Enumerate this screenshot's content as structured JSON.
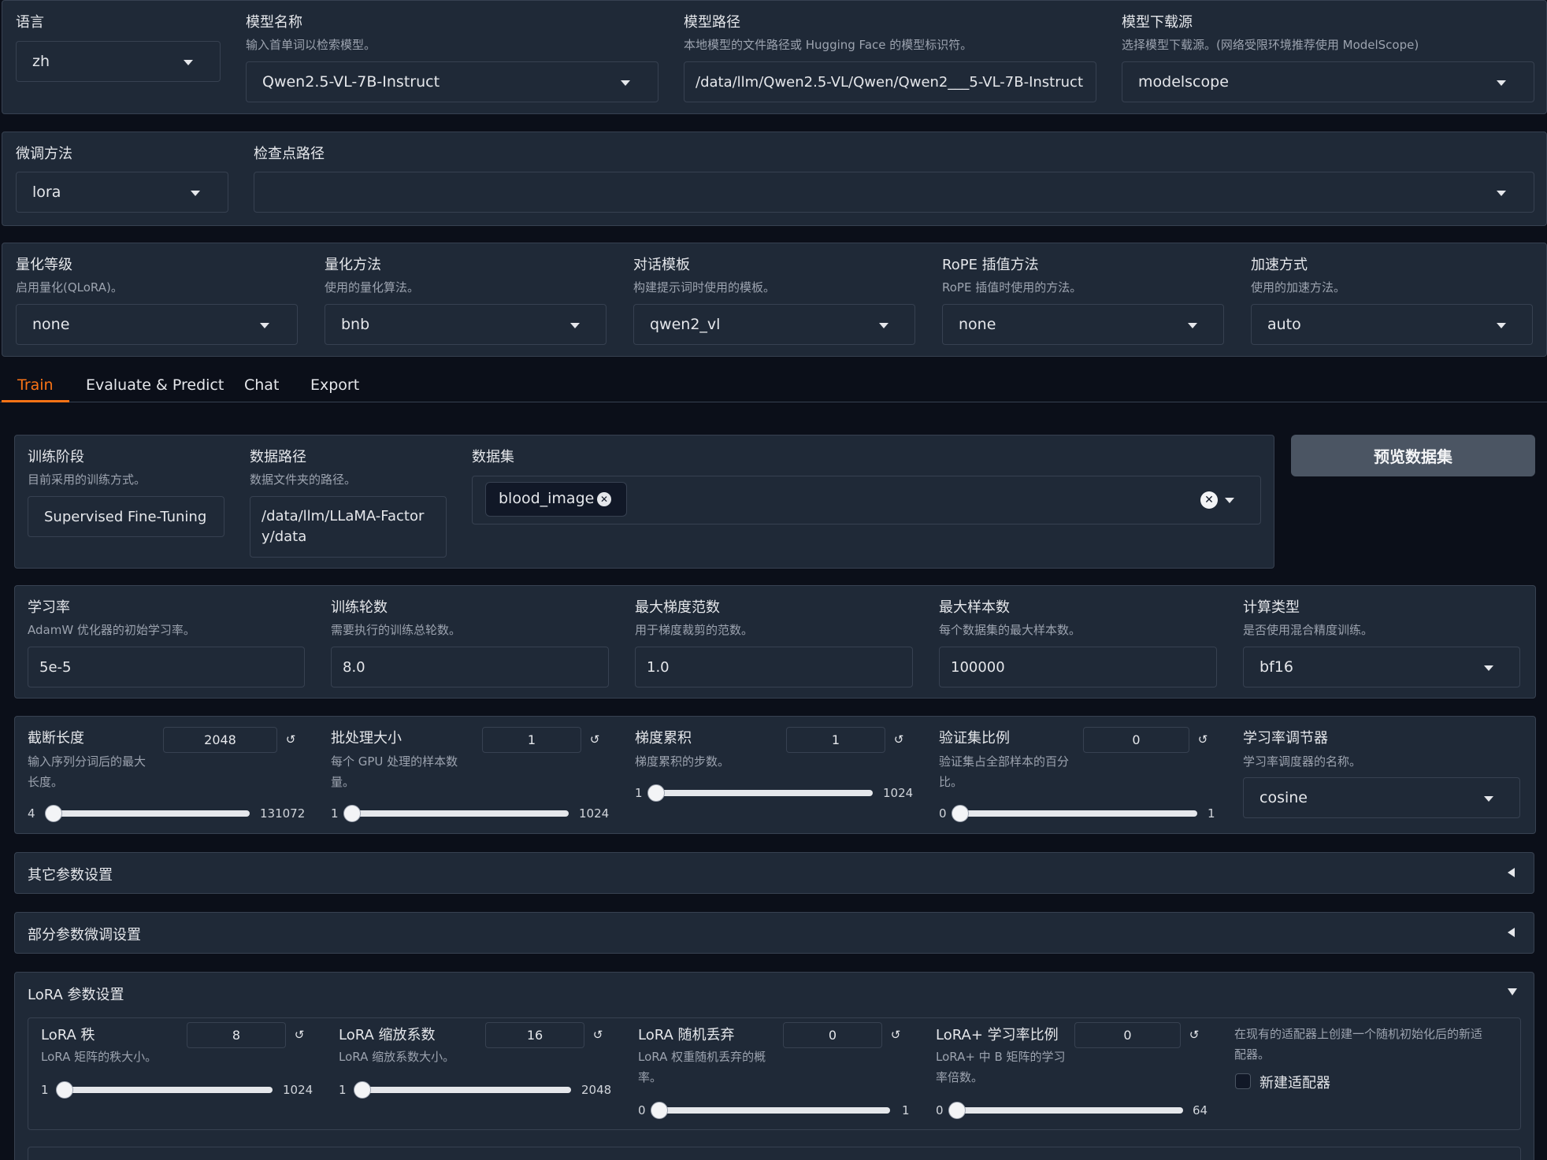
{
  "top": {
    "lang": {
      "label": "语言",
      "value": "zh"
    },
    "model_name": {
      "label": "模型名称",
      "info": "输入首单词以检索模型。",
      "value": "Qwen2.5-VL-7B-Instruct"
    },
    "model_path": {
      "label": "模型路径",
      "info": "本地模型的文件路径或 Hugging Face 的模型标识符。",
      "value": "/data/llm/Qwen2.5-VL/Qwen/Qwen2___5-VL-7B-Instruct"
    },
    "hub": {
      "label": "模型下载源",
      "info": "选择模型下载源。(网络受限环境推荐使用 ModelScope)",
      "value": "modelscope"
    }
  },
  "finetune": {
    "method": {
      "label": "微调方法",
      "value": "lora"
    },
    "checkpoint": {
      "label": "检查点路径",
      "value": ""
    }
  },
  "quant": {
    "bit": {
      "label": "量化等级",
      "info": "启用量化(QLoRA)。",
      "value": "none"
    },
    "method": {
      "label": "量化方法",
      "info": "使用的量化算法。",
      "value": "bnb"
    },
    "template": {
      "label": "对话模板",
      "info": "构建提示词时使用的模板。",
      "value": "qwen2_vl"
    },
    "rope": {
      "label": "RoPE 插值方法",
      "info": "RoPE 插值时使用的方法。",
      "value": "none"
    },
    "booster": {
      "label": "加速方式",
      "info": "使用的加速方法。",
      "value": "auto"
    }
  },
  "tabs": [
    {
      "label": "Train",
      "active": true
    },
    {
      "label": "Evaluate & Predict",
      "active": false
    },
    {
      "label": "Chat",
      "active": false
    },
    {
      "label": "Export",
      "active": false
    }
  ],
  "accent_color": "#f97316",
  "train": {
    "stage": {
      "label": "训练阶段",
      "info": "目前采用的训练方式。",
      "value": "Supervised Fine-Tuning"
    },
    "dataset_dir": {
      "label": "数据路径",
      "info": "数据文件夹的路径。",
      "value": "/data/llm/LLaMA-Factory/data"
    },
    "dataset": {
      "label": "数据集",
      "chip": "blood_image"
    },
    "preview_button": "预览数据集"
  },
  "params1": {
    "lr": {
      "label": "学习率",
      "info": "AdamW 优化器的初始学习率。",
      "value": "5e-5"
    },
    "epochs": {
      "label": "训练轮数",
      "info": "需要执行的训练总轮数。",
      "value": "8.0"
    },
    "max_grad_norm": {
      "label": "最大梯度范数",
      "info": "用于梯度裁剪的范数。",
      "value": "1.0"
    },
    "max_samples": {
      "label": "最大样本数",
      "info": "每个数据集的最大样本数。",
      "value": "100000"
    },
    "compute_type": {
      "label": "计算类型",
      "info": "是否使用混合精度训练。",
      "value": "bf16"
    }
  },
  "params2": {
    "cutoff": {
      "label": "截断长度",
      "info1": "输入序列分词后的最大",
      "info2": "长度。",
      "value": "2048",
      "min": "4",
      "max": "131072",
      "level": 0.0156
    },
    "batch": {
      "label": "批处理大小",
      "info1": "每个 GPU 处理的样本数",
      "info2": "量。",
      "value": "1",
      "min": "1",
      "max": "1024",
      "level": 0.0
    },
    "grad_acc": {
      "label": "梯度累积",
      "info1": "梯度累积的步数。",
      "value": "1",
      "min": "1",
      "max": "1024",
      "level": 0.0
    },
    "val_size": {
      "label": "验证集比例",
      "info1": "验证集占全部样本的百分",
      "info2": "比。",
      "value": "0",
      "min": "0",
      "max": "1",
      "level": 0.0
    },
    "scheduler": {
      "label": "学习率调节器",
      "info": "学习率调度器的名称。",
      "value": "cosine"
    }
  },
  "accordions": {
    "extra": "其它参数设置",
    "freeze": "部分参数微调设置",
    "lora": "LoRA 参数设置"
  },
  "lora": {
    "rank": {
      "label": "LoRA 秩",
      "info": "LoRA 矩阵的秩大小。",
      "value": "8",
      "min": "1",
      "max": "1024",
      "level": 0.0068
    },
    "alpha": {
      "label": "LoRA 缩放系数",
      "info": "LoRA 缩放系数大小。",
      "value": "16",
      "min": "1",
      "max": "2048",
      "level": 0.0073
    },
    "dropout": {
      "label": "LoRA 随机丢弃",
      "info1": "LoRA 权重随机丢弃的概",
      "info2": "率。",
      "value": "0",
      "min": "0",
      "max": "1",
      "level": 0.0
    },
    "plus_ratio": {
      "label": "LoRA+ 学习率比例",
      "info1": "LoRA+ 中 B 矩阵的学习",
      "info2": "率倍数。",
      "value": "0",
      "min": "0",
      "max": "64",
      "level": 0.0
    },
    "new_adapter": {
      "info1": "在现有的适配器上创建一个随机初始化后的新适",
      "info2": "配器。",
      "label": "新建适配器",
      "checked": false
    }
  }
}
